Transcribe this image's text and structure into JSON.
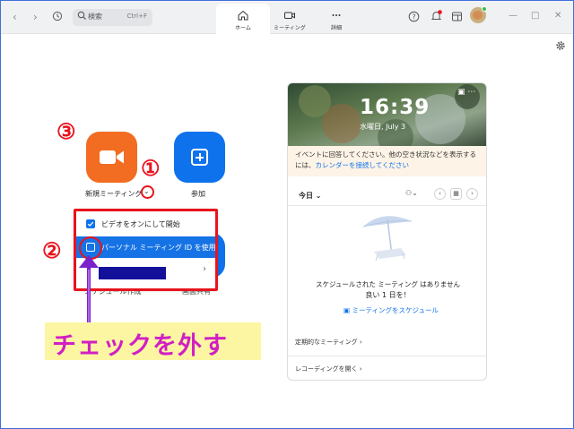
{
  "titlebar": {
    "search_placeholder": "検索",
    "search_shortcut": "Ctrl+F",
    "tabs": [
      {
        "label": "ホーム",
        "icon": "home-icon",
        "active": true
      },
      {
        "label": "ミーティング",
        "icon": "video-icon",
        "active": false
      },
      {
        "label": "詳細",
        "icon": "more-icon",
        "active": false
      }
    ]
  },
  "actions": {
    "new_meeting": "新規ミーティング",
    "join": "参加",
    "schedule_partial": "スケジュール作成",
    "share_partial": "画面共有"
  },
  "dropdown": {
    "items": [
      {
        "label": "ビデオをオンにして開始",
        "checked": true
      },
      {
        "label": "パーソナル ミーティング ID を使用",
        "checked": false,
        "highlighted": true
      },
      {
        "label": "",
        "redacted": true
      }
    ]
  },
  "annotations": {
    "n1": "①",
    "n2": "②",
    "n3": "③",
    "callout": "チェックを外す",
    "red": "#e8131d",
    "magenta": "#d11fc4"
  },
  "calendar": {
    "time": "16:39",
    "date": "水曜日, July 3",
    "notice_text": "イベントに回答してください。他の空き状況などを表示するには、",
    "notice_link": "カレンダーを接続してください",
    "today": "今日",
    "empty_line1": "スケジュールされた ミーティング はありません",
    "empty_line2": "良い 1 日を！",
    "schedule_link": "ミーティングをスケジュール",
    "recurring": "定期的なミーティング",
    "recordings": "レコーディングを開く"
  },
  "colors": {
    "accent": "#0e72ed",
    "orange": "#f26d21"
  }
}
